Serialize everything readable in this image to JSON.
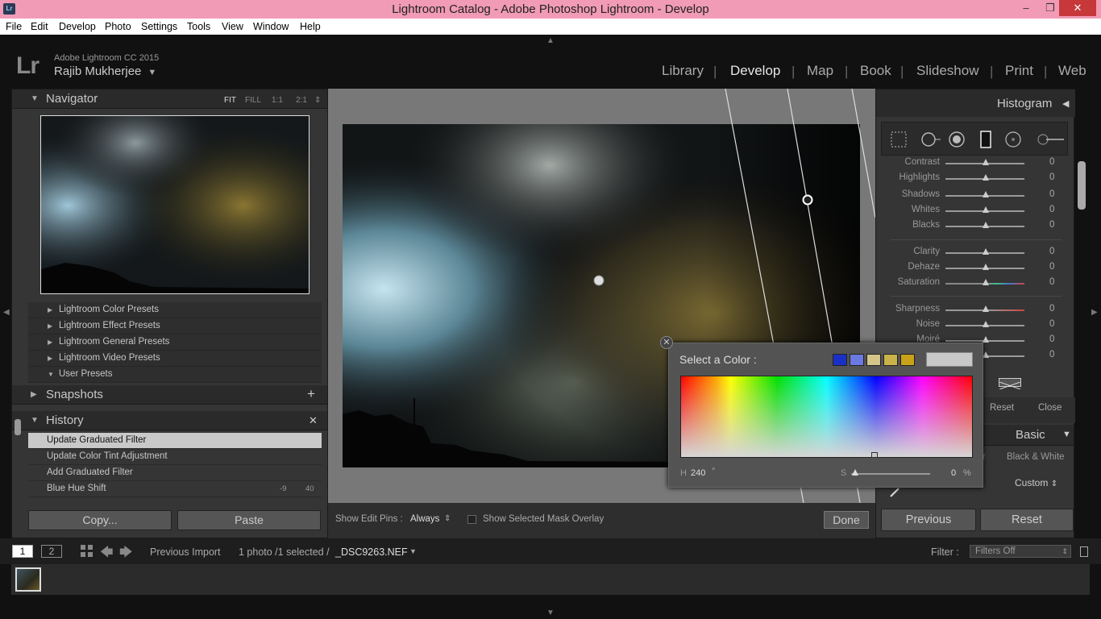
{
  "window": {
    "title": "Lightroom Catalog - Adobe Photoshop Lightroom - Develop",
    "icon": "Lr",
    "controls": [
      "–",
      "❐",
      "✕"
    ]
  },
  "menu": [
    "File",
    "Edit",
    "Develop",
    "Photo",
    "Settings",
    "Tools",
    "View",
    "Window",
    "Help"
  ],
  "identity": {
    "logo": "Lr",
    "product": "Adobe Lightroom CC 2015",
    "user": "Rajib Mukherjee",
    "caret": "▼"
  },
  "modules": [
    {
      "label": "Library",
      "active": false
    },
    {
      "label": "Develop",
      "active": true
    },
    {
      "label": "Map",
      "active": false
    },
    {
      "label": "Book",
      "active": false
    },
    {
      "label": "Slideshow",
      "active": false
    },
    {
      "label": "Print",
      "active": false
    },
    {
      "label": "Web",
      "active": false
    }
  ],
  "module_separator": "|",
  "navigator": {
    "title": "Navigator",
    "options": [
      "FIT",
      "FILL",
      "1:1",
      "2:1"
    ],
    "options_caret": "⇕"
  },
  "presets": [
    "Lightroom Color Presets",
    "Lightroom Effect Presets",
    "Lightroom General Presets",
    "Lightroom Video Presets",
    "User Presets"
  ],
  "snapshots": {
    "title": "Snapshots",
    "add": "+"
  },
  "history": {
    "title": "History",
    "clear": "✕",
    "items": [
      {
        "label": "Update Graduated Filter",
        "selected": true,
        "v1": "",
        "v2": ""
      },
      {
        "label": "Update Color Tint Adjustment",
        "selected": false,
        "v1": "",
        "v2": ""
      },
      {
        "label": "Add Graduated Filter",
        "selected": false,
        "v1": "",
        "v2": ""
      },
      {
        "label": "Blue Hue Shift",
        "selected": false,
        "v1": "-9",
        "v2": "40"
      }
    ]
  },
  "left_buttons": {
    "copy": "Copy...",
    "paste": "Paste"
  },
  "toolbar": {
    "edit_pins_label": "Show Edit Pins :",
    "edit_pins_value": "Always",
    "edit_pins_caret": "⇕",
    "mask_overlay": "Show Selected Mask Overlay",
    "done": "Done"
  },
  "right": {
    "histogram": "Histogram",
    "histogram_caret": "◀",
    "sliders_group1": [
      {
        "label": "Contrast",
        "value": "0"
      },
      {
        "label": "Highlights",
        "value": "0"
      },
      {
        "label": "Shadows",
        "value": "0"
      },
      {
        "label": "Whites",
        "value": "0"
      },
      {
        "label": "Blacks",
        "value": "0"
      }
    ],
    "sliders_group2": [
      {
        "label": "Clarity",
        "value": "0"
      },
      {
        "label": "Dehaze",
        "value": "0"
      },
      {
        "label": "Saturation",
        "value": "0"
      }
    ],
    "sliders_group3": [
      {
        "label": "Sharpness",
        "value": "0"
      },
      {
        "label": "Noise",
        "value": "0"
      },
      {
        "label": "Moiré",
        "value": "0"
      },
      {
        "label": "",
        "value": "0"
      }
    ],
    "reset": "Reset",
    "close": "Close",
    "basic": "Basic",
    "basic_caret": "▼",
    "treatment_partial": "r",
    "black_white": "Black & White",
    "profile": "Custom",
    "profile_caret": "⇕",
    "previous": "Previous",
    "reset_big": "Reset"
  },
  "color_picker": {
    "title": "Select a Color :",
    "close": "✕",
    "swatches": [
      "#1a2fc8",
      "#6a7ae0",
      "#d4c58a",
      "#c9b24a",
      "#c9a21a"
    ],
    "current": "#c8c8c8",
    "h_label": "H",
    "h_value": "240",
    "h_unit": "°",
    "s_label": "S",
    "s_value": "0",
    "s_unit": "%"
  },
  "filmbar": {
    "view1": "1",
    "view2": "2",
    "source": "Previous Import",
    "count": "1 photo /1 selected /",
    "filename": "_DSC9263.NEF",
    "file_caret": "▼",
    "filter_label": "Filter :",
    "filter_value": "Filters Off",
    "filter_caret": "⇕"
  }
}
